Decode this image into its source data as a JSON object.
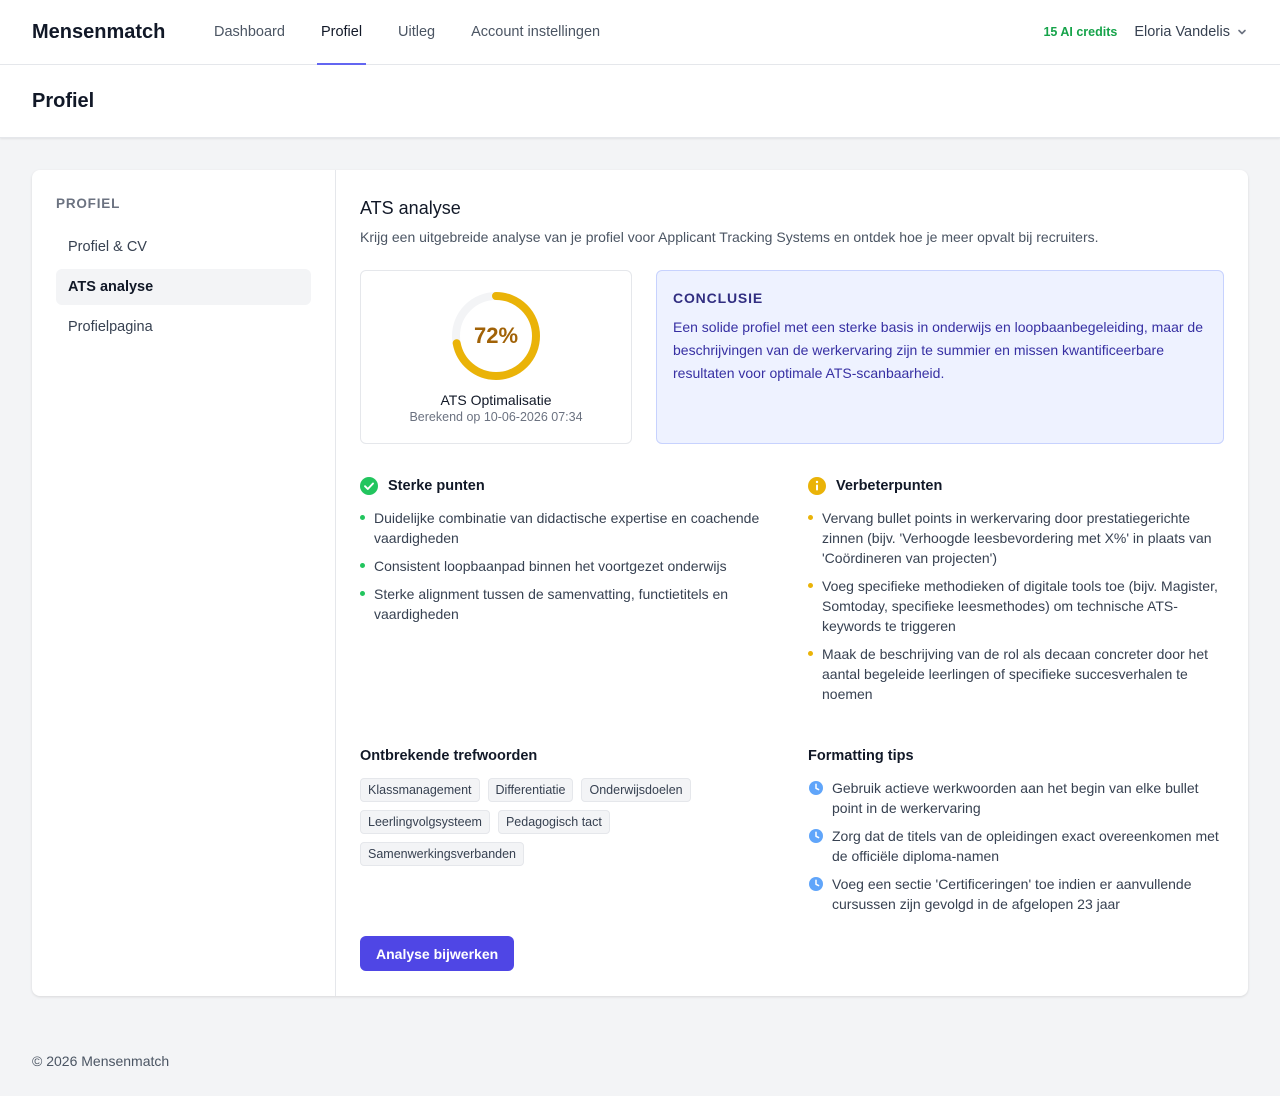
{
  "brand": "Mensenmatch",
  "nav": {
    "items": [
      {
        "label": "Dashboard"
      },
      {
        "label": "Profiel"
      },
      {
        "label": "Uitleg"
      },
      {
        "label": "Account instellingen"
      }
    ],
    "active": "Profiel"
  },
  "credits": "15 AI credits",
  "user": {
    "name": "Eloria Vandelis"
  },
  "page_title": "Profiel",
  "sidebar": {
    "title": "PROFIEL",
    "items": [
      {
        "label": "Profiel & CV"
      },
      {
        "label": "ATS analyse"
      },
      {
        "label": "Profielpagina"
      }
    ],
    "active": "ATS analyse"
  },
  "analysis": {
    "title": "ATS analyse",
    "subtitle": "Krijg een uitgebreide analyse van je profiel voor Applicant Tracking Systems en ontdek hoe je meer opvalt bij recruiters.",
    "score": 72,
    "score_label": "72%",
    "score_title": "ATS Optimalisatie",
    "score_date": "Berekend op 10-06-2026 07:34",
    "conclusion_title": "CONCLUSIE",
    "conclusion": "Een solide profiel met een sterke basis in onderwijs en loopbaanbegeleiding, maar de beschrijvingen van de werkervaring zijn te summier en missen kwantificeerbare resultaten voor optimale ATS-scanbaarheid.",
    "strengths_title": "Sterke punten",
    "strengths": [
      "Duidelijke combinatie van didactische expertise en coachende vaardigheden",
      "Consistent loopbaanpad binnen het voortgezet onderwijs",
      "Sterke alignment tussen de samenvatting, functietitels en vaardigheden"
    ],
    "improvements_title": "Verbeterpunten",
    "improvements": [
      "Vervang bullet points in werkervaring door prestatiegerichte zinnen (bijv. 'Verhoogde leesbevordering met X%' in plaats van 'Coördineren van projecten')",
      "Voeg specifieke methodieken of digitale tools toe (bijv. Magister, Somtoday, specifieke leesmethodes) om technische ATS-keywords te triggeren",
      "Maak de beschrijving van de rol als decaan concreter door het aantal begeleide leerlingen of specifieke succesverhalen te noemen"
    ],
    "keywords_title": "Ontbrekende trefwoorden",
    "keywords": [
      "Klassmanagement",
      "Differentiatie",
      "Onderwijsdoelen",
      "Leerlingvolgsysteem",
      "Pedagogisch tact",
      "Samenwerkingsverbanden"
    ],
    "tips_title": "Formatting tips",
    "tips": [
      "Gebruik actieve werkwoorden aan het begin van elke bullet point in de werkervaring",
      "Zorg dat de titels van de opleidingen exact overeenkomen met de officiële diploma-namen",
      "Voeg een sectie 'Certificeringen' toe indien er aanvullende cursussen zijn gevolgd in de afgelopen 23 jaar"
    ],
    "button": "Analyse bijwerken"
  },
  "footer": "© 2026 Mensenmatch",
  "colors": {
    "accent": "#4f46e5",
    "ring": "#eab308",
    "ring_track": "#f3f4f6",
    "success": "#22c55e",
    "warning": "#eab308",
    "info": "#60a5fa",
    "credits": "#16a34a"
  }
}
